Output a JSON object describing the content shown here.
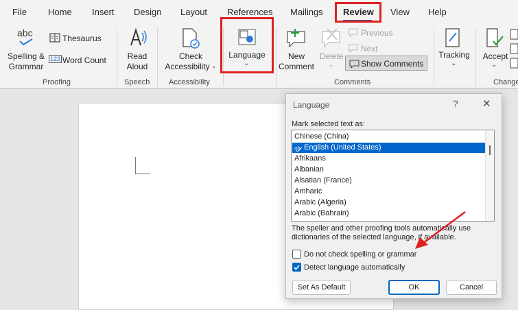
{
  "tabs": [
    "File",
    "Home",
    "Insert",
    "Design",
    "Layout",
    "References",
    "Mailings",
    "Review",
    "View",
    "Help"
  ],
  "ribbon": {
    "spelling_icon_text": "abc",
    "spelling_label_1": "Spelling &",
    "spelling_label_2": "Grammar",
    "thesaurus": "Thesaurus",
    "word_count_icon_text": "123",
    "word_count": "Word Count",
    "read_aloud_1": "Read",
    "read_aloud_2": "Aloud",
    "check_access_1": "Check",
    "check_access_2": "Accessibility",
    "language": "Language",
    "new_comment_1": "New",
    "new_comment_2": "Comment",
    "delete": "Delete",
    "previous": "Previous",
    "next": "Next",
    "show_comments": "Show Comments",
    "tracking": "Tracking",
    "accept": "Accept",
    "groups": {
      "proofing": "Proofing",
      "speech": "Speech",
      "accessibility": "Accessibility",
      "comments": "Comments",
      "changes": "Change"
    }
  },
  "dialog": {
    "title": "Language",
    "help": "?",
    "close": "✕",
    "list_label": "Mark selected text as:",
    "languages": [
      "Chinese (China)",
      "English (United States)",
      "Afrikaans",
      "Albanian",
      "Alsatian (France)",
      "Amharic",
      "Arabic (Algeria)",
      "Arabic (Bahrain)"
    ],
    "selected_language": "English (United States)",
    "info_line_1": "The speller and other proofing tools automatically use",
    "info_line_2": "dictionaries of the selected language, if available.",
    "no_check_label": "Do not check spelling or grammar",
    "no_check_checked": false,
    "detect_label": "Detect language automatically",
    "detect_checked": true,
    "set_default": "Set As Default",
    "ok": "OK",
    "cancel": "Cancel"
  },
  "colors": {
    "highlight": "#e02020",
    "accent": "#0067c0",
    "selection": "#0066cc"
  }
}
